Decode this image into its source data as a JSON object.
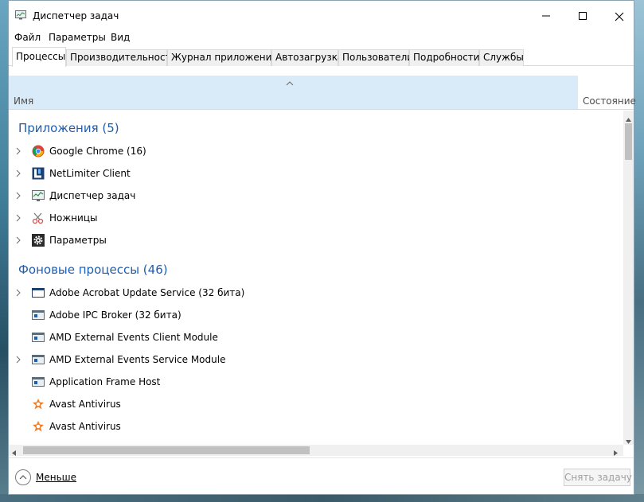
{
  "window": {
    "title": "Диспетчер задач"
  },
  "menu": [
    "Файл",
    "Параметры",
    "Вид"
  ],
  "tabs": [
    "Процессы",
    "Производительность",
    "Журнал приложений",
    "Автозагрузка",
    "Пользователи",
    "Подробности",
    "Службы"
  ],
  "columns": {
    "name": "Имя",
    "status": "Состояние"
  },
  "groups": {
    "apps": "Приложения (5)",
    "background": "Фоновые процессы (46)"
  },
  "apps": [
    {
      "name": "Google Chrome (16)",
      "icon": "chrome-icon",
      "expandable": true
    },
    {
      "name": "NetLimiter Client",
      "icon": "netlimiter-icon",
      "expandable": true
    },
    {
      "name": "Диспетчер задач",
      "icon": "task-manager-icon",
      "expandable": true
    },
    {
      "name": "Ножницы",
      "icon": "snipping-tool-icon",
      "expandable": true
    },
    {
      "name": "Параметры",
      "icon": "gear-icon",
      "expandable": true
    }
  ],
  "background": [
    {
      "name": "Adobe Acrobat Update Service (32 бита)",
      "icon": "window-icon",
      "expandable": true
    },
    {
      "name": "Adobe IPC Broker (32 бита)",
      "icon": "service-icon",
      "expandable": false
    },
    {
      "name": "AMD External Events Client Module",
      "icon": "service-icon",
      "expandable": false
    },
    {
      "name": "AMD External Events Service Module",
      "icon": "service-icon",
      "expandable": true
    },
    {
      "name": "Application Frame Host",
      "icon": "service-icon",
      "expandable": false
    },
    {
      "name": "Avast Antivirus",
      "icon": "avast-icon",
      "expandable": false
    },
    {
      "name": "Avast Antivirus",
      "icon": "avast-icon",
      "expandable": false
    }
  ],
  "footer": {
    "fewer": "Меньше",
    "end_task": "Снять задачу"
  },
  "colors": {
    "group_title": "#1e5db0",
    "header_bg": "#d9ebf9",
    "avast": "#f47b20"
  }
}
